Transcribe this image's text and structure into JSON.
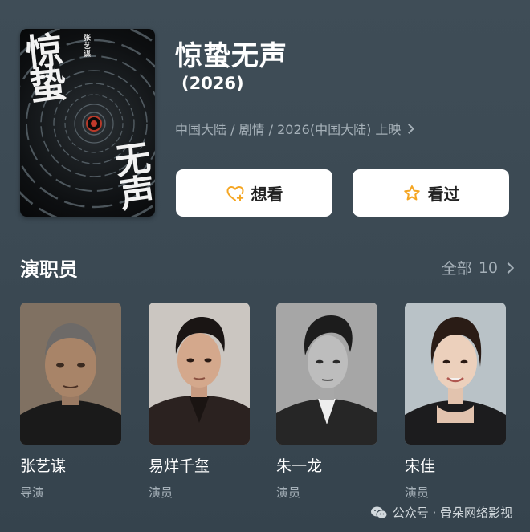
{
  "movie": {
    "title": "惊蛰无声",
    "year": "(2026)",
    "meta": "中国大陆 / 剧情 / 2026(中国大陆) 上映",
    "poster": {
      "title_top": "惊蛰",
      "title_bottom": "无声",
      "credit": "张艺谋"
    }
  },
  "actions": {
    "want_label": "想看",
    "seen_label": "看过",
    "icon_color": "#f5a623"
  },
  "cast": {
    "header": "演职员",
    "all_label": "全部",
    "all_count": "10",
    "members": [
      {
        "name": "张艺谋",
        "role": "导演"
      },
      {
        "name": "易烊千玺",
        "role": "演员"
      },
      {
        "name": "朱一龙",
        "role": "演员"
      },
      {
        "name": "宋佳",
        "role": "演员"
      }
    ]
  },
  "watermark": {
    "text": "公众号 · 骨朵网络影视"
  }
}
